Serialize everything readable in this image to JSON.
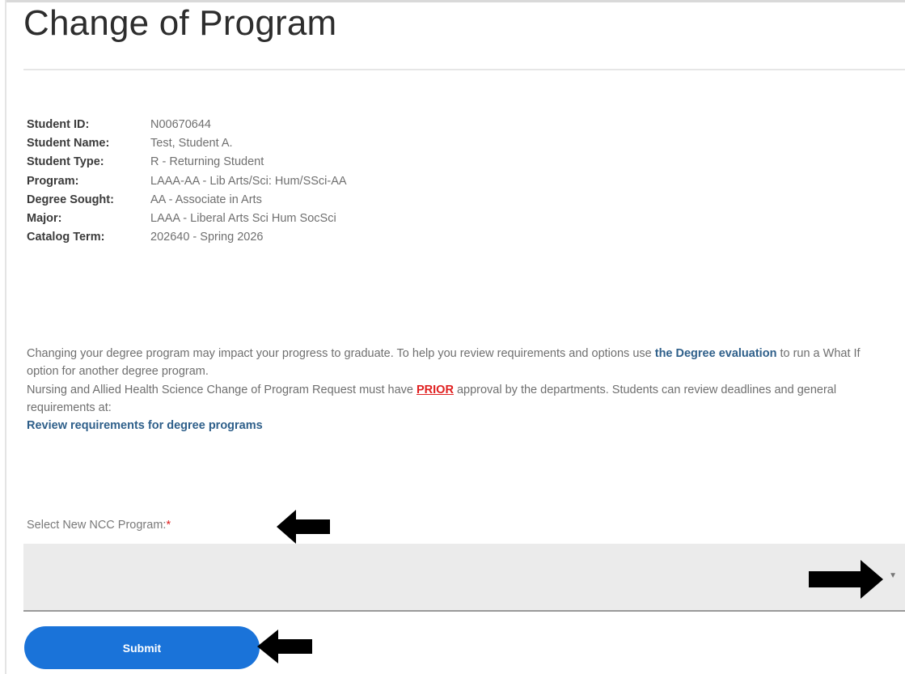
{
  "page": {
    "title": "Change of Program"
  },
  "student_info": [
    {
      "label": "Student ID:",
      "value": "N00670644"
    },
    {
      "label": "Student Name:",
      "value": "Test, Student A."
    },
    {
      "label": "Student Type:",
      "value": "R - Returning Student"
    },
    {
      "label": "Program:",
      "value": "LAAA-AA - Lib Arts/Sci: Hum/SSci-AA"
    },
    {
      "label": "Degree Sought:",
      "value": "AA - Associate in Arts"
    },
    {
      "label": "Major:",
      "value": "LAAA - Liberal Arts Sci Hum SocSci"
    },
    {
      "label": "Catalog Term:",
      "value": "202640 - Spring 2026"
    }
  ],
  "notice1": {
    "text_a": "Changing your degree program may impact your progress to graduate. To help you review requirements and options use ",
    "link": "the Degree evaluation",
    "text_b": " to run a What If option for another degree program."
  },
  "notice2": {
    "text_a": "Nursing and Allied Health Science Change of Program Request must have ",
    "prior": "PRIOR",
    "text_b": " approval by the departments. Students can review deadlines and general requirements at:",
    "link": "Review requirements for degree programs"
  },
  "program_select": {
    "label": "Select New NCC Program:",
    "required_marker": "*",
    "value": ""
  },
  "submit_label": "Submit",
  "icons": {
    "caret": "chevron-down-icon",
    "arrow": "arrow-annotation-icon"
  },
  "colors": {
    "accent": "#1a73d9",
    "link": "#2e5f8a",
    "required": "#e02020"
  }
}
